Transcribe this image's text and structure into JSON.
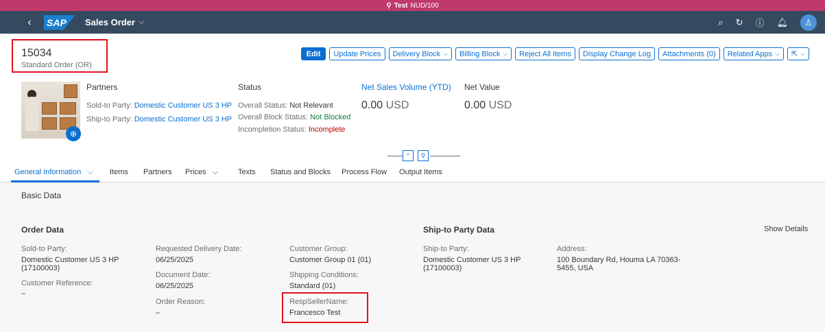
{
  "system": {
    "label": "Test",
    "client": "NUD/100"
  },
  "shell": {
    "app_title": "Sales Order"
  },
  "object": {
    "number": "15034",
    "type": "Standard Order (OR)"
  },
  "actions": [
    {
      "label": "Edit",
      "primary": true,
      "dropdown": false
    },
    {
      "label": "Update Prices",
      "dropdown": false
    },
    {
      "label": "Delivery Block",
      "dropdown": true
    },
    {
      "label": "Billing Block",
      "dropdown": true
    },
    {
      "label": "Reject All Items",
      "dropdown": false
    },
    {
      "label": "Display Change Log",
      "dropdown": false
    },
    {
      "label": "Attachments (0)",
      "dropdown": false
    },
    {
      "label": "Related Apps",
      "dropdown": true
    }
  ],
  "partners": {
    "title": "Partners",
    "sold_to_label": "Sold-to Party:",
    "sold_to_value": "Domestic Customer US 3 HP",
    "ship_to_label": "Ship-to Party:",
    "ship_to_value": "Domestic Customer US 3 HP"
  },
  "status": {
    "title": "Status",
    "overall_label": "Overall Status:",
    "overall_value": "Not Relevant",
    "block_label": "Overall Block Status:",
    "block_value": "Not Blocked",
    "incompletion_label": "Incompletion Status:",
    "incompletion_value": "Incomplete"
  },
  "kpis": {
    "net_sales_title": "Net Sales Volume (YTD)",
    "net_sales_amount": "0.00",
    "net_sales_unit": "USD",
    "net_value_title": "Net Value",
    "net_value_amount": "0.00",
    "net_value_unit": "USD"
  },
  "tabs": [
    "General Information",
    "Items",
    "Partners",
    "Prices",
    "Texts",
    "Status and Blocks",
    "Process Flow",
    "Output Items"
  ],
  "basic_data": {
    "title": "Basic Data",
    "order_data_title": "Order Data",
    "ship_to_data_title": "Ship-to Party Data",
    "show_details": "Show Details",
    "sold_to_label": "Sold-to Party:",
    "sold_to_value_1": "Domestic Customer US 3 HP",
    "sold_to_value_2": "(17100003)",
    "customer_ref_label": "Customer Reference:",
    "customer_ref_value": "–",
    "req_delivery_label": "Requested Delivery Date:",
    "req_delivery_value": "06/25/2025",
    "doc_date_label": "Document Date:",
    "doc_date_value": "06/25/2025",
    "order_reason_label": "Order Reason:",
    "order_reason_value": "–",
    "customer_group_label": "Customer Group:",
    "customer_group_value": "Customer Group 01 (01)",
    "shipping_cond_label": "Shipping Conditions:",
    "shipping_cond_value": "Standard (01)",
    "resp_seller_label": "RespSellerName:",
    "resp_seller_value": "Francesco Test",
    "ship_to_label": "Ship-to Party:",
    "ship_to_value_1": "Domestic Customer US 3 HP",
    "ship_to_value_2": "(17100003)",
    "address_label": "Address:",
    "address_value_1": "100 Boundary Rd, Houma LA 70363-",
    "address_value_2": "5455, USA"
  },
  "colors": {
    "brand_bar": "#c0396b",
    "shell": "#354a5f",
    "accent": "#0a6ed1",
    "highlight": "#e0101c"
  }
}
